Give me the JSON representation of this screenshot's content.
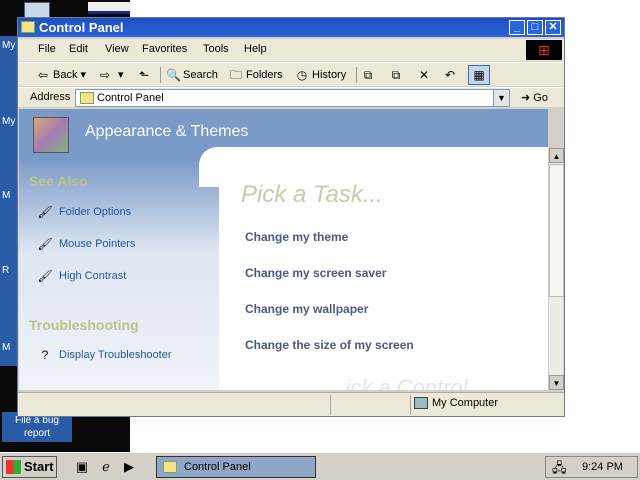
{
  "desktop": {
    "labels": [
      "My",
      "My",
      "M",
      "R",
      "M"
    ],
    "file_bug": "File a bug report"
  },
  "window": {
    "title": "Control Panel",
    "buttons": {
      "minimize": "_",
      "maximize": "□",
      "close": "✕"
    }
  },
  "menu": {
    "items": [
      "File",
      "Edit",
      "View",
      "Favorites",
      "Tools",
      "Help"
    ]
  },
  "toolbar": {
    "back": "Back",
    "search": "Search",
    "folders": "Folders",
    "history": "History"
  },
  "address": {
    "label": "Address",
    "value": "Control Panel",
    "go": "Go"
  },
  "banner": {
    "title": "Appearance & Themes"
  },
  "side": {
    "see_also_heading": "See Also",
    "see_also": [
      "Folder Options",
      "Mouse Pointers",
      "High Contrast"
    ],
    "troubleshooting_heading": "Troubleshooting",
    "troubleshooters": [
      "Display Troubleshooter"
    ]
  },
  "main": {
    "pick_task": "Pick a Task...",
    "tasks": [
      "Change my theme",
      "Change my screen saver",
      "Change my wallpaper",
      "Change the size of my screen"
    ],
    "faded_text": "...ick a Control ..."
  },
  "status": {
    "zone": "My Computer"
  },
  "taskbar": {
    "start": "Start",
    "task_button": "Control Panel",
    "clock": "9:24 PM"
  },
  "colors": {
    "titlebar": "#2b63d8",
    "banner": "#7a9ac7",
    "link": "#1e5a9e",
    "task": "#4a5a7a"
  }
}
